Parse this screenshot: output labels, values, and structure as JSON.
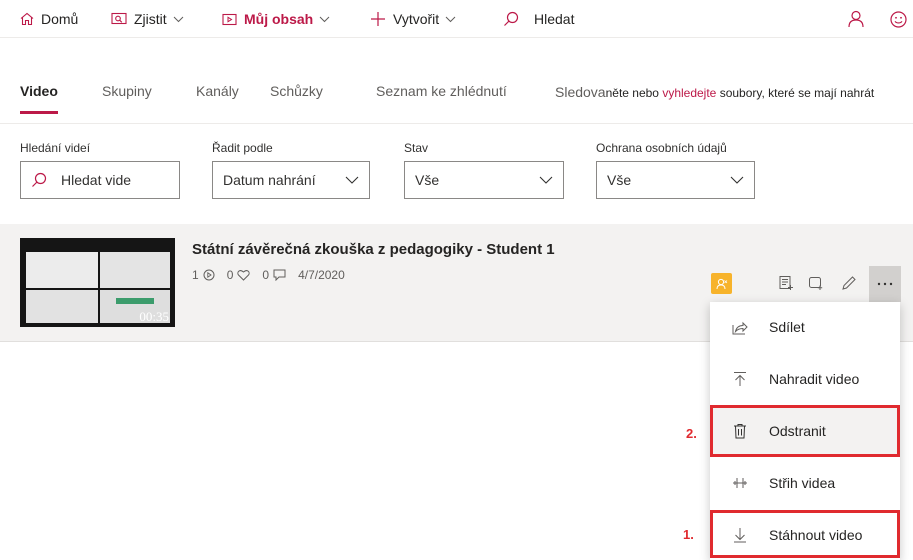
{
  "nav": {
    "home": "Domů",
    "discover": "Zjistit",
    "my_content": "Můj obsah",
    "create": "Vytvořit",
    "search": "Hledat"
  },
  "tabs": {
    "video": "Video",
    "groups": "Skupiny",
    "channels": "Kanály",
    "meetings": "Schůzky",
    "watchlist": "Seznam ke zhlédnutí",
    "followed": "Sledova",
    "hint_prefix": "něte nebo ",
    "hint_link": "vyhledejte",
    "hint_suffix": " soubory, které se mají nahrát"
  },
  "filters": {
    "search_label": "Hledání videí",
    "search_placeholder": "Hledat vide",
    "sort_label": "Řadit podle",
    "sort_value": "Datum nahrání",
    "status_label": "Stav",
    "status_value": "Vše",
    "privacy_label": "Ochrana osobních údajů",
    "privacy_value": "Vše"
  },
  "video": {
    "title": "Státní závěrečná zkouška z pedagogiky - Student 1",
    "views": "1",
    "likes": "0",
    "comments": "0",
    "date": "4/7/2020",
    "duration": "00:35"
  },
  "menu": {
    "share": "Sdílet",
    "replace": "Nahradit video",
    "delete": "Odstranit",
    "trim": "Střih videa",
    "download": "Stáhnout video"
  },
  "annotations": {
    "step1": "1.",
    "step2": "2."
  },
  "colors": {
    "accent": "#bc1948",
    "annotation_red": "#e02a2f",
    "owner_badge": "#f7b32b"
  }
}
